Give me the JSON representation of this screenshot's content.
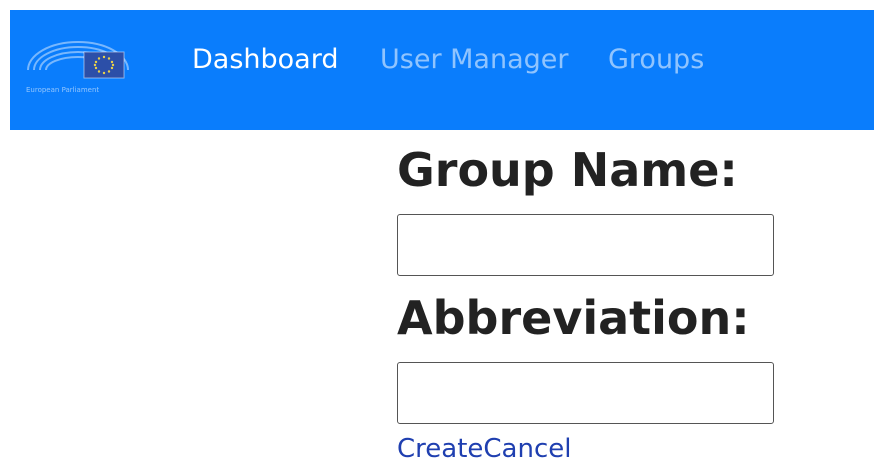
{
  "nav": {
    "logo_icon": "european-parliament-logo-icon",
    "logo_text": "European Parliament",
    "items": [
      {
        "label": "Dashboard",
        "active": true
      },
      {
        "label": "User Manager",
        "active": false
      },
      {
        "label": "Groups",
        "active": false
      }
    ],
    "background_color": "#0a7dfc"
  },
  "form": {
    "group_name_label": "Group Name:",
    "group_name_value": "",
    "abbreviation_label": "Abbreviation:",
    "abbreviation_value": "",
    "create_label": "Create",
    "cancel_label": "Cancel"
  }
}
